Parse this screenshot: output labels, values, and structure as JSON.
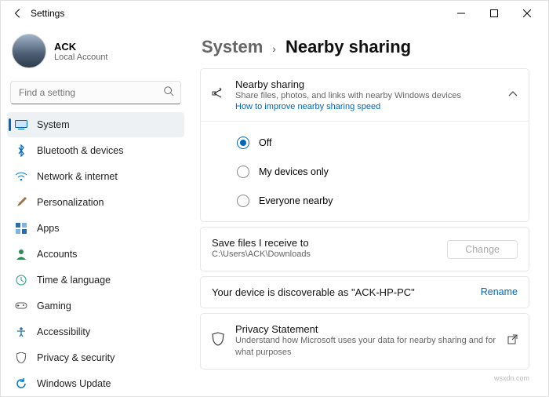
{
  "window": {
    "title": "Settings"
  },
  "account": {
    "name": "ACK",
    "sub": "Local Account"
  },
  "search": {
    "placeholder": "Find a setting"
  },
  "nav": {
    "items": [
      {
        "label": "System"
      },
      {
        "label": "Bluetooth & devices"
      },
      {
        "label": "Network & internet"
      },
      {
        "label": "Personalization"
      },
      {
        "label": "Apps"
      },
      {
        "label": "Accounts"
      },
      {
        "label": "Time & language"
      },
      {
        "label": "Gaming"
      },
      {
        "label": "Accessibility"
      },
      {
        "label": "Privacy & security"
      },
      {
        "label": "Windows Update"
      }
    ]
  },
  "breadcrumb": {
    "parent": "System",
    "current": "Nearby sharing"
  },
  "nearby": {
    "title": "Nearby sharing",
    "sub": "Share files, photos, and links with nearby Windows devices",
    "link": "How to improve nearby sharing speed",
    "radios": [
      {
        "label": "Off",
        "selected": true
      },
      {
        "label": "My devices only",
        "selected": false
      },
      {
        "label": "Everyone nearby",
        "selected": false
      }
    ]
  },
  "saveFiles": {
    "title": "Save files I receive to",
    "path": "C:\\Users\\ACK\\Downloads",
    "action": "Change"
  },
  "discoverable": {
    "text": "Your device is discoverable as \"ACK-HP-PC\"",
    "action": "Rename"
  },
  "privacy": {
    "title": "Privacy Statement",
    "sub": "Understand how Microsoft uses your data for nearby sharing and for what purposes"
  },
  "watermark": "wsxdn.com"
}
